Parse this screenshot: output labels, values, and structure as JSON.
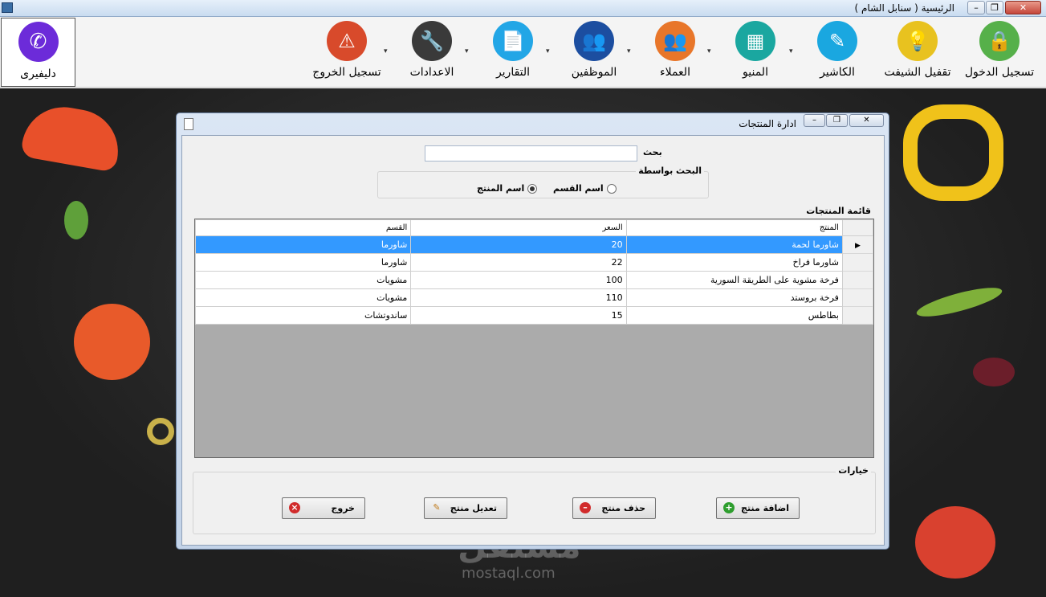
{
  "window": {
    "title": "الرئيسية ( سنابل الشام )",
    "min": "–",
    "max": "❐",
    "close": "✕"
  },
  "ribbon": {
    "items": [
      {
        "label": "تسجيل الدخول",
        "icon": "lock-icon",
        "color": "#56b04a",
        "glyph": "🔒"
      },
      {
        "label": "تقفيل الشيفت",
        "icon": "lightbulb-icon",
        "color": "#e8c21f",
        "glyph": "💡"
      },
      {
        "label": "الكاشير",
        "icon": "cashier-icon",
        "color": "#1aa7e0",
        "glyph": "✎"
      },
      {
        "label": "المنيو",
        "icon": "grid-icon",
        "color": "#1aa7a0",
        "glyph": "▦"
      },
      {
        "label": "العملاء",
        "icon": "customers-icon",
        "color": "#e8762a",
        "glyph": "👥"
      },
      {
        "label": "الموظفين",
        "icon": "employees-icon",
        "color": "#1c4ea0",
        "glyph": "👥"
      },
      {
        "label": "التقارير",
        "icon": "report-icon",
        "color": "#22a6e6",
        "glyph": "📄"
      },
      {
        "label": "الاعدادات",
        "icon": "wrench-icon",
        "color": "#3a3a3a",
        "glyph": "🔧"
      },
      {
        "label": "تسجيل الخروج",
        "icon": "warning-icon",
        "color": "#d84a2b",
        "glyph": "⚠"
      }
    ],
    "delivery": {
      "label": "دليفيرى",
      "glyph": "✆"
    }
  },
  "dialog": {
    "title": "ادارة المنتجات",
    "search_label": "بحث",
    "search_value": "",
    "search_by_title": "البحث بواسطة",
    "radio_category": "اسم القسم",
    "radio_product": "اسم المنتج",
    "selected_radio": "product",
    "products_title": "قائمة المنتجات",
    "columns": [
      "المنتج",
      "السعر",
      "القسم"
    ],
    "rows": [
      {
        "product": "شاورما لحمة",
        "price": "20",
        "category": "شاورما",
        "selected": true
      },
      {
        "product": "شاورما فراخ",
        "price": "22",
        "category": "شاورما",
        "selected": false
      },
      {
        "product": "فرخة مشوية على الطريقة السورية",
        "price": "100",
        "category": "مشويات",
        "selected": false
      },
      {
        "product": "فرخة بروستد",
        "price": "110",
        "category": "مشويات",
        "selected": false
      },
      {
        "product": "بطاطس",
        "price": "15",
        "category": "ساندوتشات",
        "selected": false
      }
    ],
    "options_title": "خيارات",
    "buttons": {
      "add": "اضافة منتج",
      "delete": "حذف منتج",
      "edit": "تعديل منتج",
      "exit": "خروج"
    }
  },
  "watermark": {
    "ar": "مستقل",
    "en": "mostaql.com"
  }
}
